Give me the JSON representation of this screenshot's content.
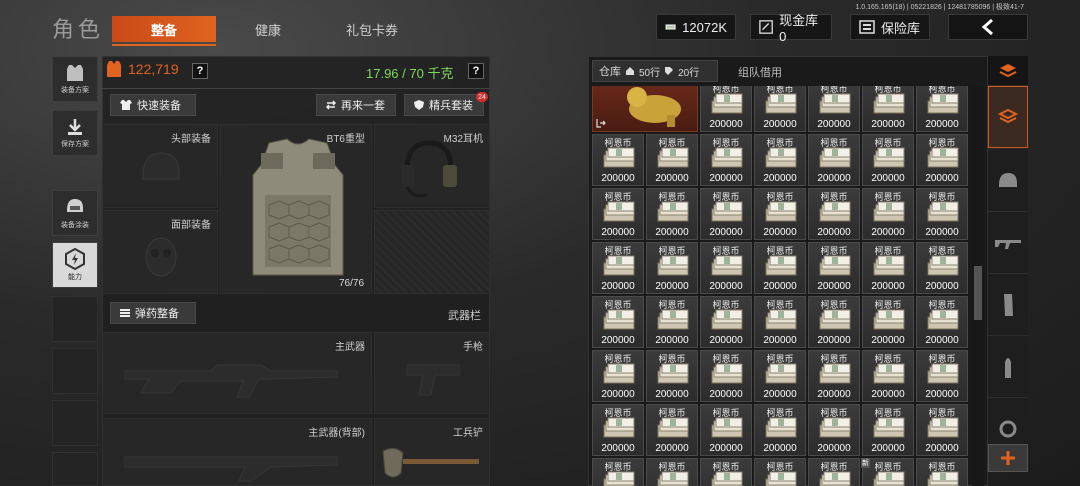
{
  "header": {
    "title": "角色",
    "tabs": [
      {
        "label": "整备",
        "active": true
      },
      {
        "label": "健康",
        "active": false
      },
      {
        "label": "礼包卡券",
        "active": false
      }
    ],
    "version": "1.0.165.165(18) | 05221826 | 12481785096 | 极致41-7",
    "currency": "12072K",
    "cash_vault": "现金库 0",
    "safe_vault": "保险库",
    "back": "<"
  },
  "rail": {
    "items": [
      {
        "label": "装备方案",
        "icon": "vest-icon"
      },
      {
        "label": "保存方案",
        "icon": "download-icon"
      },
      {
        "label": "装备涂装",
        "icon": "helmet-paint-icon"
      },
      {
        "label": "能力",
        "icon": "ability-icon",
        "active": true
      }
    ]
  },
  "equipment": {
    "value": "122,719",
    "weight": "17.96 / 70 千克",
    "quick_equip": "快速装备",
    "again": "再来一套",
    "elite": "精兵套装",
    "elite_badge": "24",
    "head_label": "头部装备",
    "face_label": "面部装备",
    "armor_label": "BT6重型",
    "armor_durability": "76/76",
    "headset_label": "M32耳机",
    "ammo_button": "弹药整备",
    "weapon_bar": "武器栏",
    "primary": "主武器",
    "pistol": "手枪",
    "primary_back": "主武器(背部)",
    "shovel": "工兵铲"
  },
  "warehouse": {
    "tab_warehouse": "仓库",
    "rows_a": "50行",
    "rows_b": "20行",
    "tab_team": "组队借用",
    "item_name": "柯恩币",
    "item_qty": "200000",
    "new_badge": "新"
  },
  "colors": {
    "accent": "#e0631f",
    "weight_green": "#7ed957",
    "value_orange": "#e0631f"
  }
}
